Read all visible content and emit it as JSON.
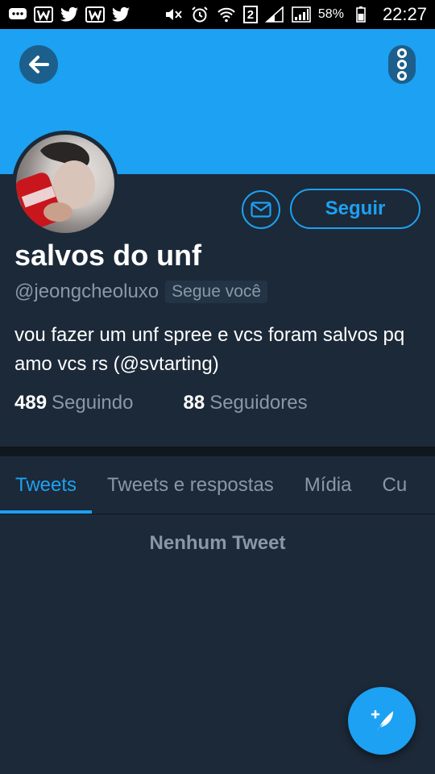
{
  "status_bar": {
    "battery_percent": "58%",
    "time": "22:27",
    "sim_badge": "2",
    "left_icons": [
      "chat-icon",
      "w-icon",
      "twitter-icon",
      "w-icon",
      "twitter-icon"
    ],
    "right_icons": [
      "mute-icon",
      "alarm-icon",
      "wifi-icon",
      "signal-icon",
      "signal-icon",
      "battery-icon"
    ]
  },
  "header": {
    "banner_color": "#1da1f2",
    "back_icon": "arrow-left-icon",
    "more_icon": "more-vertical-icon"
  },
  "profile": {
    "name": "salvos do unf",
    "handle": "@jeongcheoluxo",
    "follows_you": "Segue você",
    "bio": "vou fazer um unf spree e vcs foram salvos pq amo vcs rs (@svtarting)",
    "following_count": "489",
    "following_label": "Seguindo",
    "followers_count": "88",
    "followers_label": "Seguidores",
    "follow_button": "Seguir",
    "message_icon": "envelope-icon"
  },
  "tabs": [
    {
      "label": "Tweets",
      "active": true
    },
    {
      "label": "Tweets e respostas",
      "active": false
    },
    {
      "label": "Mídia",
      "active": false
    },
    {
      "label": "Cu",
      "active": false
    }
  ],
  "content": {
    "empty_text": "Nenhum Tweet"
  },
  "fab": {
    "icon": "compose-feather-icon"
  },
  "colors": {
    "accent": "#1da1f2",
    "background": "#1c2938",
    "muted_text": "#8899a6"
  }
}
